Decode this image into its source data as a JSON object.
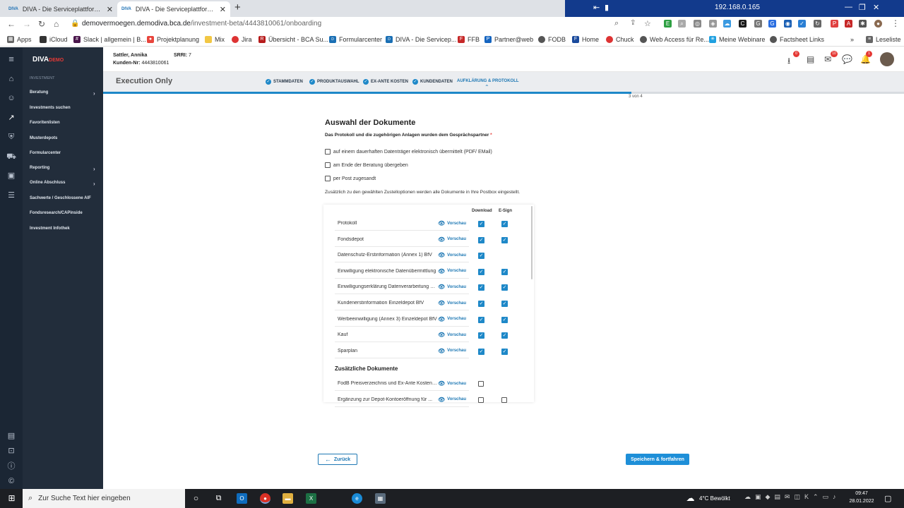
{
  "browser": {
    "tabs": [
      {
        "favicon": "DIVA",
        "title": "DIVA - Die Serviceplattform für V"
      },
      {
        "favicon": "DIVA",
        "title": "DIVA - Die Serviceplattform für V"
      }
    ],
    "remote_ip": "192.168.0.165",
    "url_host": "demovermoegen.demodiva.bca.de",
    "url_path": "/investment-beta/4443810061/onboarding",
    "bookmarks": [
      "Apps",
      "iCloud",
      "Slack | allgemein | B...",
      "Projektplanung",
      "Mix",
      "Jira",
      "Übersicht - BCA Su...",
      "Formularcenter",
      "DIVA - Die Servicep...",
      "FFB",
      "Partner@web",
      "FODB",
      "Home",
      "Chuck",
      "Web Access für Re...",
      "Meine Webinare",
      "Factsheet Links"
    ],
    "reading_list": "Leseliste",
    "more": "»"
  },
  "app": {
    "logo_main": "DIVA",
    "logo_sub": "DEMO",
    "section_label": "INVESTMENT",
    "nav_items": [
      {
        "label": "Beratung",
        "arrow": "›"
      },
      {
        "label": "Investments suchen",
        "arrow": ""
      },
      {
        "label": "Favoritenlisten",
        "arrow": ""
      },
      {
        "label": "Musterdepots",
        "arrow": ""
      },
      {
        "label": "Formularcenter",
        "arrow": ""
      },
      {
        "label": "Reporting",
        "arrow": "›"
      },
      {
        "label": "Online Abschluss",
        "arrow": "›"
      },
      {
        "label": "Sachwerte / Geschlossene AIF",
        "arrow": ""
      },
      {
        "label": "Fondsresearch/CAPinside",
        "arrow": ""
      },
      {
        "label": "Investment Infothek",
        "arrow": ""
      }
    ]
  },
  "header": {
    "client_name": "Sattler, Annika",
    "client_nr_label": "Kunden-Nr:",
    "client_nr": "4443810061",
    "srri_label": "SRRI:",
    "srri": "7",
    "badges": {
      "download": "0",
      "mail": "10",
      "bell": "1"
    }
  },
  "subheader": {
    "title": "Execution Only",
    "steps": [
      "STAMMDATEN",
      "PRODUKTAUSWAHL",
      "EX-ANTE KOSTEN",
      "KUNDENDATEN",
      "AUFKLÄRUNG & PROTOKOLL"
    ],
    "step_counter": "3 von 4",
    "progress": 0.66
  },
  "content": {
    "heading": "Auswahl der Dokumente",
    "subheading": "Das Protokoll und die zugehörigen Anlagen wurden dem Gesprächspartner",
    "required_mark": "*",
    "delivery_options": [
      "auf einem dauerhaften Datenträger elektronisch übermittelt (PDF/ EMail)",
      "am Ende der Beratung übergeben",
      "per Post zugesandt"
    ],
    "note": "Zusätzlich zu den gewählten Zustelloptionen werden alle Dokumente in Ihre Postbox eingestellt.",
    "col_download": "Download",
    "col_esign": "E-Sign",
    "preview_label": "Vorschau",
    "documents": [
      {
        "name": "Protokoll",
        "download": true,
        "esign": true
      },
      {
        "name": "Fondsdepot",
        "download": true,
        "esign": true
      },
      {
        "name": "Datenschutz-Erstinformation (Annex 1) BfV",
        "download": true,
        "esign": null
      },
      {
        "name": "Einwilligung elektronische Datenübermittlung",
        "download": true,
        "esign": true
      },
      {
        "name": "Einwilligungserklärung Datenverarbeitung Ei...",
        "download": true,
        "esign": true
      },
      {
        "name": "Kundenerstinformation Einzeldepot BfV",
        "download": true,
        "esign": true
      },
      {
        "name": "Werbeeinwilligung (Annex 3) Einzeldepot BfV",
        "download": true,
        "esign": true
      },
      {
        "name": "Kauf",
        "download": true,
        "esign": true
      },
      {
        "name": "Sparplan",
        "download": true,
        "esign": true
      }
    ],
    "additional_heading": "Zusätzliche Dokumente",
    "additional_documents": [
      {
        "name": "FodB Preisverzeichnis und Ex-Ante Kostena...",
        "download": false,
        "esign": null
      },
      {
        "name": "Ergänzung zur Depot-Kontoeröffnung für ...",
        "download": false,
        "esign": false
      }
    ],
    "back_button": "Zurück",
    "next_button": "Speichern & fortfahren"
  },
  "taskbar": {
    "search_placeholder": "Zur Suche Text hier eingeben",
    "weather": "4°C  Bewölkt",
    "time": "09:47",
    "date": "28.01.2022"
  }
}
